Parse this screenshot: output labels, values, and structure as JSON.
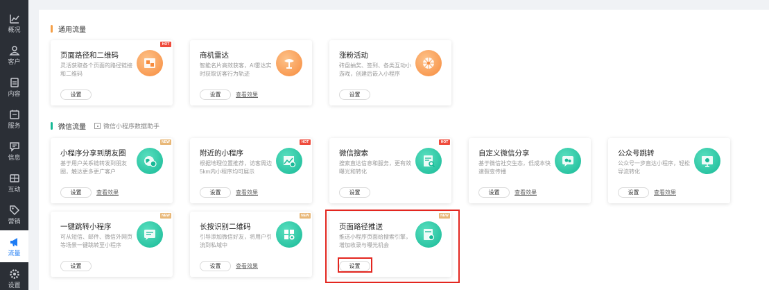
{
  "sidebar": {
    "items": [
      {
        "label": "概况",
        "icon": "chart-icon"
      },
      {
        "label": "客户",
        "icon": "user-icon"
      },
      {
        "label": "内容",
        "icon": "document-icon"
      },
      {
        "label": "服务",
        "icon": "service-icon"
      },
      {
        "label": "信息",
        "icon": "message-icon"
      },
      {
        "label": "互动",
        "icon": "interaction-icon"
      },
      {
        "label": "营销",
        "icon": "tag-icon"
      },
      {
        "label": "流量",
        "icon": "megaphone-icon"
      },
      {
        "label": "设置",
        "icon": "gear-icon"
      }
    ],
    "active": "流量"
  },
  "sections": {
    "general": {
      "title": "通用流量",
      "accent": "#f5a048"
    },
    "wechat": {
      "title": "微信流量",
      "accent": "#17b996",
      "helper": "微信小程序数据助手"
    }
  },
  "cards": [
    {
      "title": "页面路径和二维码",
      "desc": "灵活获取各个页面的路径链接和二维码",
      "badge": "HOT",
      "btn": "设置",
      "link": ""
    },
    {
      "title": "商机雷达",
      "desc": "智能名片高效获客，AI雷达实时获取访客行为轨迹",
      "badge": "",
      "btn": "设置",
      "link": "查看效果"
    },
    {
      "title": "涨粉活动",
      "desc": "砖盘抽奖、签到、各类互动小游戏，创建后嵌入小程序",
      "badge": "",
      "btn": "设置",
      "link": ""
    },
    {
      "title": "小程序分享到朋友圈",
      "desc": "基于用户关系链转发到朋友圈，触达更多更广客户",
      "badge": "NEW",
      "btn": "设置",
      "link": "查看效果"
    },
    {
      "title": "附近的小程序",
      "desc": "根据地理位置推荐，访客周边5km内小程序均可展示",
      "badge": "HOT",
      "btn": "设置",
      "link": "查看效果"
    },
    {
      "title": "微信搜索",
      "desc": "搜索直达信息和服务，更有效曝光和转化",
      "badge": "HOT",
      "btn": "设置",
      "link": ""
    },
    {
      "title": "自定义微信分享",
      "desc": "基于微信社交生态，低成本快速裂变传播",
      "badge": "",
      "btn": "设置",
      "link": "查看效果"
    },
    {
      "title": "公众号跳转",
      "desc": "公众号一步直达小程序，轻松导流转化",
      "badge": "",
      "btn": "设置",
      "link": "查看效果"
    },
    {
      "title": "一键跳转小程序",
      "desc": "可从短信、邮件、微信外网页等场景一键跳转至小程序",
      "badge": "NEW",
      "btn": "设置",
      "link": ""
    },
    {
      "title": "长按识别二维码",
      "desc": "引导添加微信好友，将用户引流到私域中",
      "badge": "NEW",
      "btn": "设置",
      "link": "查看效果"
    },
    {
      "title": "页面路径推送",
      "desc": "推送小程序页面给搜索引擎，增加收录与曝光机会",
      "badge": "NEW",
      "btn": "设置",
      "link": ""
    }
  ],
  "colors": {
    "orange_icon": "#f78b3d",
    "teal_icon": "#17b996",
    "highlight": "#e3261f",
    "hot": "#ef4b3c",
    "new": "#e8b777"
  }
}
